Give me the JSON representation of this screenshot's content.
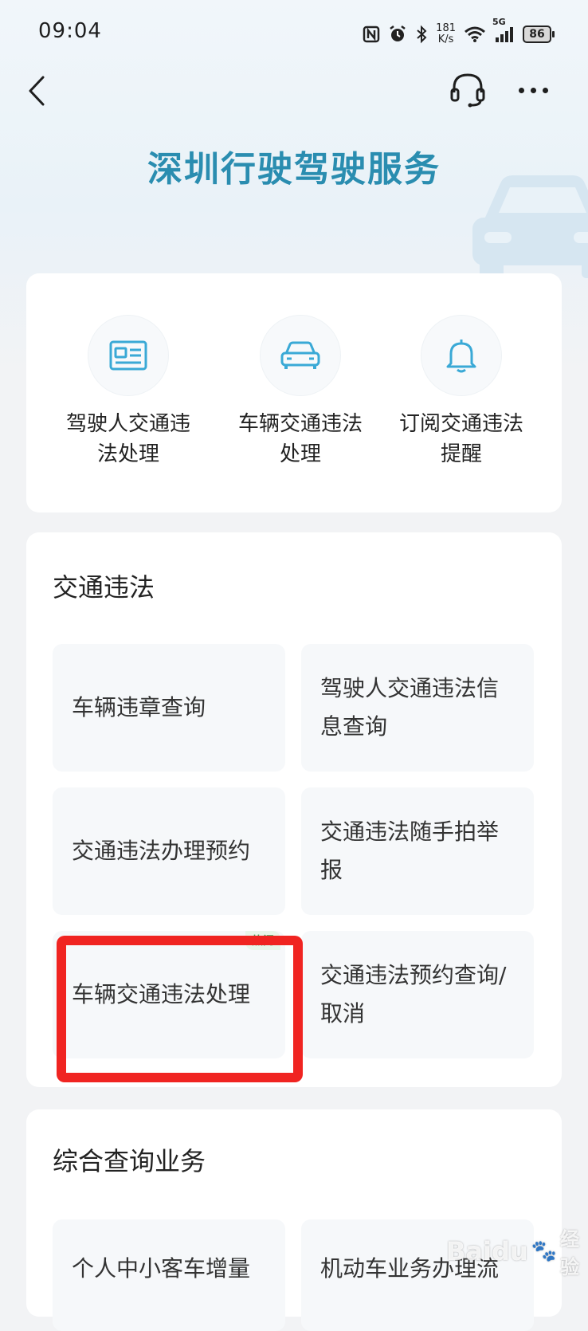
{
  "status_bar": {
    "time": "09:04",
    "net_speed_value": "181",
    "net_speed_unit": "K/s",
    "signal_label": "5G",
    "battery": "86"
  },
  "nav": {
    "back_icon": "chevron-left-icon",
    "support_icon": "headset-icon",
    "more_icon": "more-dots-icon"
  },
  "page": {
    "title": "深圳行驶驾驶服务"
  },
  "quick_actions": [
    {
      "label": "驾驶人交通违法处理",
      "icon": "id-card-icon"
    },
    {
      "label": "车辆交通违法处理",
      "icon": "car-icon"
    },
    {
      "label": "订阅交通违法提醒",
      "icon": "bell-icon"
    }
  ],
  "violation_section": {
    "title": "交通违法",
    "tiles": [
      {
        "label": "车辆违章查询"
      },
      {
        "label": "驾驶人交通违法信息查询"
      },
      {
        "label": "交通违法办理预约"
      },
      {
        "label": "交通违法随手拍举报"
      },
      {
        "label": "车辆交通违法处理",
        "badge": "热门"
      },
      {
        "label": "交通违法预约查询/取消"
      }
    ]
  },
  "query_section": {
    "title": "综合查询业务",
    "tiles": [
      {
        "label": "个人中小客车增量"
      },
      {
        "label": "机动车业务办理流"
      }
    ]
  },
  "watermark": {
    "text": "Baidu",
    "suffix": "经验"
  },
  "colors": {
    "title": "#2a8db0",
    "icon": "#3aa9d6",
    "highlight": "#f02421",
    "tile_bg": "#f6f8fa"
  }
}
